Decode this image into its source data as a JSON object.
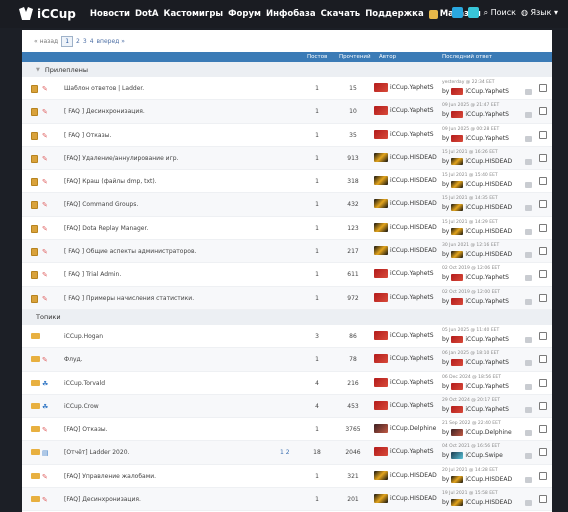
{
  "header": {
    "logo_text": "iCCup",
    "nav": [
      "Новости",
      "DotA",
      "Кастомигры",
      "Форум",
      "Инфобаза",
      "Скачать",
      "Поддержка"
    ],
    "shop_label": "Магазин",
    "search_label": "Поиск",
    "lang_label": "Язык"
  },
  "pager": {
    "back": "« назад",
    "pages": [
      "1",
      "2",
      "3",
      "4"
    ],
    "forward": "вперед »"
  },
  "columns": {
    "posts": "Постов",
    "views": "Прочтений",
    "author": "Автор",
    "last_reply": "Последний ответ"
  },
  "sections": {
    "pinned": "Прилеплены",
    "topics": "Топики"
  },
  "pinned": [
    {
      "title": "Шаблон ответов | Ladder.",
      "posts": "1",
      "views": "15",
      "author": "iCCup.YaphetS",
      "av": "red",
      "lr_date": "yesterday @ 22:34 EET",
      "lr_by": "iCCup.YaphetS",
      "lr_av": "red"
    },
    {
      "title": "[ FAQ ] Десинхронизация.",
      "posts": "1",
      "views": "10",
      "author": "iCCup.YaphetS",
      "av": "red",
      "lr_date": "09 Jun 2025 @ 21:47 EET",
      "lr_by": "iCCup.YaphetS",
      "lr_av": "red"
    },
    {
      "title": "[ FAQ ] Отказы.",
      "posts": "1",
      "views": "35",
      "author": "iCCup.YaphetS",
      "av": "red",
      "lr_date": "09 Jun 2025 @ 00:28 EET",
      "lr_by": "iCCup.YaphetS",
      "lr_av": "red"
    },
    {
      "title": "[FAQ] Удаление/аннулирование игр.",
      "posts": "1",
      "views": "913",
      "author": "iCCup.HISDEAD",
      "av": "yel",
      "lr_date": "15 Jul 2021 @ 16:26 EET",
      "lr_by": "iCCup.HISDEAD",
      "lr_av": "yel"
    },
    {
      "title": "[FAQ] Краш (файлы dmp, txt).",
      "posts": "1",
      "views": "318",
      "author": "iCCup.HISDEAD",
      "av": "yel",
      "lr_date": "15 Jul 2021 @ 15:40 EET",
      "lr_by": "iCCup.HISDEAD",
      "lr_av": "yel"
    },
    {
      "title": "[FAQ] Command Groups.",
      "posts": "1",
      "views": "432",
      "author": "iCCup.HISDEAD",
      "av": "yel",
      "lr_date": "15 Jul 2021 @ 14:35 EET",
      "lr_by": "iCCup.HISDEAD",
      "lr_av": "yel"
    },
    {
      "title": "[FAQ] Dota Replay Manager.",
      "posts": "1",
      "views": "123",
      "author": "iCCup.HISDEAD",
      "av": "yel",
      "lr_date": "15 Jul 2021 @ 14:29 EET",
      "lr_by": "iCCup.HISDEAD",
      "lr_av": "yel"
    },
    {
      "title": "[ FAQ ] Общие аспекты администраторов.",
      "posts": "1",
      "views": "217",
      "author": "iCCup.HISDEAD",
      "av": "yel",
      "lr_date": "30 Jun 2021 @ 12:16 EET",
      "lr_by": "iCCup.HISDEAD",
      "lr_av": "yel"
    },
    {
      "title": "[ FAQ ] Trial Admin.",
      "posts": "1",
      "views": "611",
      "author": "iCCup.YaphetS",
      "av": "red",
      "lr_date": "02 Oct 2019 @ 12:06 EET",
      "lr_by": "iCCup.YaphetS",
      "lr_av": "red"
    },
    {
      "title": "[ FAQ ] Примеры начисления статистики.",
      "posts": "1",
      "views": "972",
      "author": "iCCup.YaphetS",
      "av": "red",
      "lr_date": "02 Oct 2019 @ 12:00 EET",
      "lr_by": "iCCup.YaphetS",
      "lr_av": "red"
    }
  ],
  "topics": [
    {
      "title": "iCCup.Hogan",
      "icon": "envelope",
      "pages": "",
      "posts": "3",
      "views": "86",
      "author": "iCCup.YaphetS",
      "av": "red",
      "lr_date": "05 Jun 2025 @ 11:40 EET",
      "lr_by": "iCCup.YaphetS",
      "lr_av": "red"
    },
    {
      "title": "Флуд.",
      "icon": "pencil",
      "pages": "",
      "posts": "1",
      "views": "78",
      "author": "iCCup.YaphetS",
      "av": "red",
      "lr_date": "06 Jan 2025 @ 18:10 EET",
      "lr_by": "iCCup.YaphetS",
      "lr_av": "red"
    },
    {
      "title": "iCCup.Torvald",
      "icon": "crowd",
      "pages": "",
      "posts": "4",
      "views": "216",
      "author": "iCCup.YaphetS",
      "av": "red",
      "lr_date": "06 Dec 2024 @ 18:56 EET",
      "lr_by": "iCCup.YaphetS",
      "lr_av": "red"
    },
    {
      "title": "iCCup.Crow",
      "icon": "crowd",
      "pages": "",
      "posts": "4",
      "views": "453",
      "author": "iCCup.YaphetS",
      "av": "red",
      "lr_date": "29 Oct 2024 @ 20:17 EET",
      "lr_by": "iCCup.YaphetS",
      "lr_av": "red"
    },
    {
      "title": "[FAQ] Отказы.",
      "icon": "pencil",
      "pages": "",
      "posts": "1",
      "views": "3765",
      "author": "iCCup.Delphine",
      "av": "dark",
      "lr_date": "21 Sep 2022 @ 22:40 EET",
      "lr_by": "iCCup.Delphine",
      "lr_av": "dark"
    },
    {
      "title": "[Отчёт] Ladder 2020.",
      "icon": "doc",
      "pages": "1 2",
      "posts": "18",
      "views": "2046",
      "author": "iCCup.YaphetS",
      "av": "red",
      "lr_date": "04 Oct 2021 @ 16:56 EET",
      "lr_by": "iCCup.Swipe",
      "lr_av": "cyan"
    },
    {
      "title": "[FAQ] Управление жалобами.",
      "icon": "pencil",
      "pages": "",
      "posts": "1",
      "views": "321",
      "author": "iCCup.HISDEAD",
      "av": "yel",
      "lr_date": "20 Jul 2021 @ 14:28 EET",
      "lr_by": "iCCup.HISDEAD",
      "lr_av": "yel"
    },
    {
      "title": "[FAQ] Десинхронизация.",
      "icon": "pencil",
      "pages": "",
      "posts": "1",
      "views": "201",
      "author": "iCCup.HISDEAD",
      "av": "yel",
      "lr_date": "19 Jul 2021 @ 15:58 EET",
      "lr_by": "iCCup.HISDEAD",
      "lr_av": "yel"
    }
  ],
  "by_prefix": "by",
  "colors": {
    "header_bg": "#1a1c22",
    "table_head": "#3b7bb6",
    "accent": "#2aa8e0"
  }
}
